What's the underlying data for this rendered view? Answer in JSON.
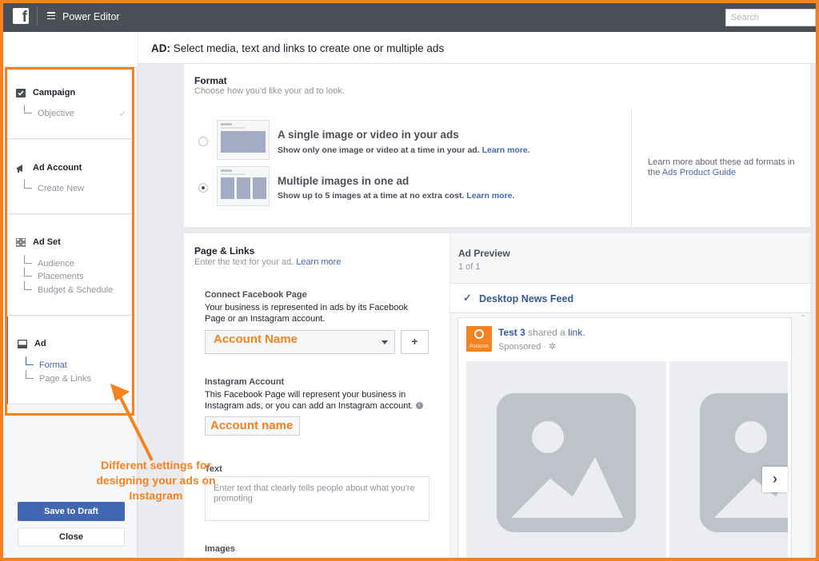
{
  "topbar": {
    "app_title": "Power Editor",
    "search_placeholder": "Search"
  },
  "sidebar": {
    "campaign": {
      "title": "Campaign",
      "items": [
        "Objective"
      ]
    },
    "ad_account": {
      "title": "Ad Account",
      "items": [
        "Create New"
      ]
    },
    "ad_set": {
      "title": "Ad Set",
      "items": [
        "Audience",
        "Placements",
        "Budget & Schedule"
      ]
    },
    "ad": {
      "title": "Ad",
      "items": [
        "Format",
        "Page & Links"
      ]
    },
    "save_label": "Save to Draft",
    "close_label": "Close"
  },
  "annotation": {
    "note": "Different settings for designing your ads on Instagram",
    "color": "#f5821f"
  },
  "header": {
    "prefix": "AD:",
    "text": "Select media, text and links to create one or multiple ads"
  },
  "format": {
    "title": "Format",
    "subtitle": "Choose how you'd like your ad to look.",
    "options": [
      {
        "title": "A single image or video in your ads",
        "desc": "Show only one image or video at a time in your ad.",
        "link": "Learn more.",
        "selected": false
      },
      {
        "title": "Multiple images in one ad",
        "desc": "Show up to 5 images at a time at no extra cost.",
        "link": "Learn more.",
        "selected": true
      }
    ],
    "side_note": "Learn more about these ad formats in the",
    "side_link": "Ads Product Guide"
  },
  "page_links": {
    "title": "Page & Links",
    "subtitle": "Enter the text for your ad.",
    "subtitle_link": "Learn more",
    "connect_label": "Connect Facebook Page",
    "connect_desc": "Your business is represented in ads by its Facebook Page or an Instagram account.",
    "account_name": "Account Name",
    "plus": "+",
    "instagram_label": "Instagram Account",
    "instagram_desc": "This Facebook Page will represent your business in Instagram ads, or you can add an Instagram account.",
    "instagram_account": "Account name",
    "text_label": "Text",
    "text_placeholder": "Enter text that clearly tells people about what you're promoting",
    "images_label": "Images"
  },
  "preview": {
    "title": "Ad Preview",
    "count": "1 of 1",
    "feed": "Desktop News Feed",
    "post_name": "Test 3",
    "post_action": "shared a",
    "post_link": "link.",
    "post_sponsored": "Sponsored · ",
    "logo_word": "Postcron",
    "brand_color": "#f5821f",
    "accent": "#4267b2"
  }
}
